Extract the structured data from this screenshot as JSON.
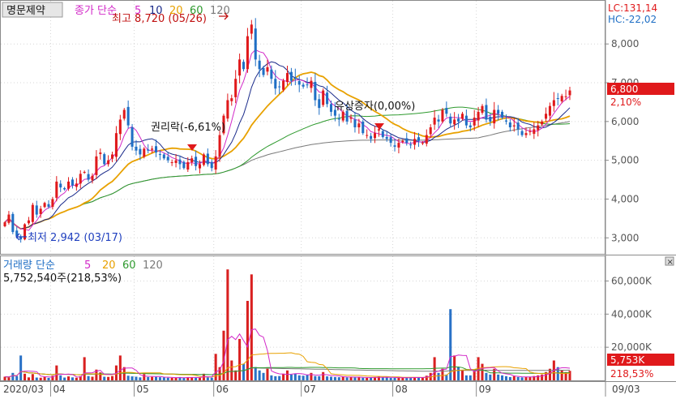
{
  "chart_data": {
    "type": "candlestick",
    "title": "명문제약",
    "price_legend": {
      "label": "종가 단순",
      "periods": [
        "5",
        "10",
        "20",
        "60",
        "120"
      ]
    },
    "volume_legend": {
      "label": "거래량 단순",
      "periods": [
        "5",
        "20",
        "60",
        "120"
      ]
    },
    "colors": {
      "up": "#e0191b",
      "down": "#1f6fc5",
      "ma5": "#d229c8",
      "ma10": "#1a2a8a",
      "ma20": "#e8a100",
      "ma60": "#2e9a2e",
      "ma120": "#7a7a7a",
      "price_tag": "#e0191b",
      "lc": "#e0191b",
      "hc": "#1f6fc5",
      "arrow_blue": "#1f3fbf"
    },
    "x_ticks": [
      "2020/03",
      "04",
      "05",
      "06",
      "07",
      "08",
      "09"
    ],
    "x_end_label": "09/03",
    "y_ticks": [
      "3,000",
      "4,000",
      "5,000",
      "6,000",
      "7,000",
      "8,000"
    ],
    "y_range": [
      2650,
      9050
    ],
    "lc_text": "LC:131,14",
    "hc_text": "HC:-22,02",
    "last_price_text": "6,800",
    "last_change_text": "2,10%",
    "annotations": {
      "high": "최고 8,720 (05/26)",
      "low": "최저 2,942 (03/17)",
      "rights": "권리락(-6,61%)",
      "capital": "유상증자(0,00%)"
    },
    "volume": {
      "y_ticks": [
        "20,000K",
        "40,000K",
        "60,000K"
      ],
      "y_max": 72000,
      "current_text": "5,752,540주(218,53%)",
      "last_volume_text": "5,753K",
      "last_ratio_text": "218,53%"
    },
    "months": [
      {
        "label": "2020/03",
        "count": 12
      },
      {
        "label": "04",
        "count": 21
      },
      {
        "label": "05",
        "count": 20
      },
      {
        "label": "06",
        "count": 22
      },
      {
        "label": "07",
        "count": 23
      },
      {
        "label": "08",
        "count": 21
      },
      {
        "label": "09",
        "count": 3
      }
    ],
    "closes": [
      3400,
      3600,
      3150,
      3050,
      2960,
      3350,
      3450,
      3850,
      3600,
      3750,
      3900,
      3800,
      4000,
      4450,
      4300,
      4250,
      4450,
      4350,
      4400,
      4650,
      4700,
      4500,
      4600,
      5100,
      5200,
      4900,
      5000,
      5150,
      5700,
      6050,
      6300,
      5900,
      5350,
      5250,
      5150,
      5300,
      5250,
      5300,
      5200,
      5150,
      5050,
      5000,
      4950,
      5000,
      4900,
      4800,
      4950,
      5050,
      4850,
      4900,
      5150,
      4900,
      4800,
      5100,
      5650,
      6150,
      6550,
      6600,
      7100,
      7600,
      7350,
      8200,
      8500,
      7600,
      7350,
      7200,
      7400,
      7100,
      6850,
      6900,
      7050,
      7250,
      7050,
      7100,
      6950,
      6900,
      6950,
      7050,
      6550,
      6350,
      6800,
      6450,
      6250,
      6150,
      6050,
      6250,
      6000,
      6100,
      5850,
      5950,
      5700,
      5650,
      5550,
      5700,
      5800,
      5600,
      5550,
      5450,
      5350,
      5450,
      5500,
      5450,
      5400,
      5550,
      5500,
      5450,
      5650,
      5850,
      6100,
      6000,
      6300,
      6200,
      5950,
      6050,
      6000,
      6200,
      5900,
      5850,
      6100,
      6250,
      6400,
      6050,
      6000,
      6300,
      6200,
      6100,
      6000,
      5850,
      5900,
      5800,
      5650,
      5700,
      5750,
      5800,
      5900,
      6000,
      6200,
      6400,
      6550,
      6600,
      6660,
      6650,
      6800
    ],
    "volumes": [
      2200,
      1800,
      4500,
      2600,
      15000,
      4000,
      1800,
      3800,
      1700,
      1600,
      2000,
      1500,
      2800,
      9000,
      3000,
      1700,
      2400,
      1800,
      1600,
      2500,
      14000,
      2600,
      2200,
      6500,
      4800,
      2200,
      2100,
      2600,
      9000,
      15000,
      8000,
      2800,
      2400,
      2200,
      1800,
      3800,
      2000,
      2100,
      2100,
      1900,
      1800,
      1600,
      1500,
      1600,
      2000,
      1500,
      2000,
      1800,
      1600,
      1500,
      4000,
      1800,
      1600,
      16000,
      8000,
      30000,
      67000,
      12000,
      6000,
      25000,
      10000,
      48000,
      64000,
      8000,
      6000,
      4500,
      7000,
      3000,
      2500,
      2600,
      4000,
      6000,
      3500,
      4000,
      3000,
      2800,
      3200,
      4500,
      2600,
      2500,
      5000,
      2400,
      2200,
      2000,
      1900,
      2400,
      1800,
      2000,
      1700,
      1900,
      1600,
      1500,
      1800,
      1900,
      2200,
      1900,
      1800,
      1500,
      1500,
      1700,
      1800,
      1700,
      1500,
      1800,
      1800,
      1800,
      2800,
      4500,
      14000,
      4500,
      7000,
      3500,
      43000,
      15000,
      8000,
      6000,
      3000,
      3000,
      6000,
      14000,
      10000,
      4500,
      3500,
      7000,
      3500,
      3000,
      2500,
      2000,
      2500,
      2000,
      1800,
      2000,
      2000,
      2600,
      3000,
      3500,
      5000,
      7000,
      12000,
      8000,
      6000,
      5000,
      5753
    ]
  }
}
